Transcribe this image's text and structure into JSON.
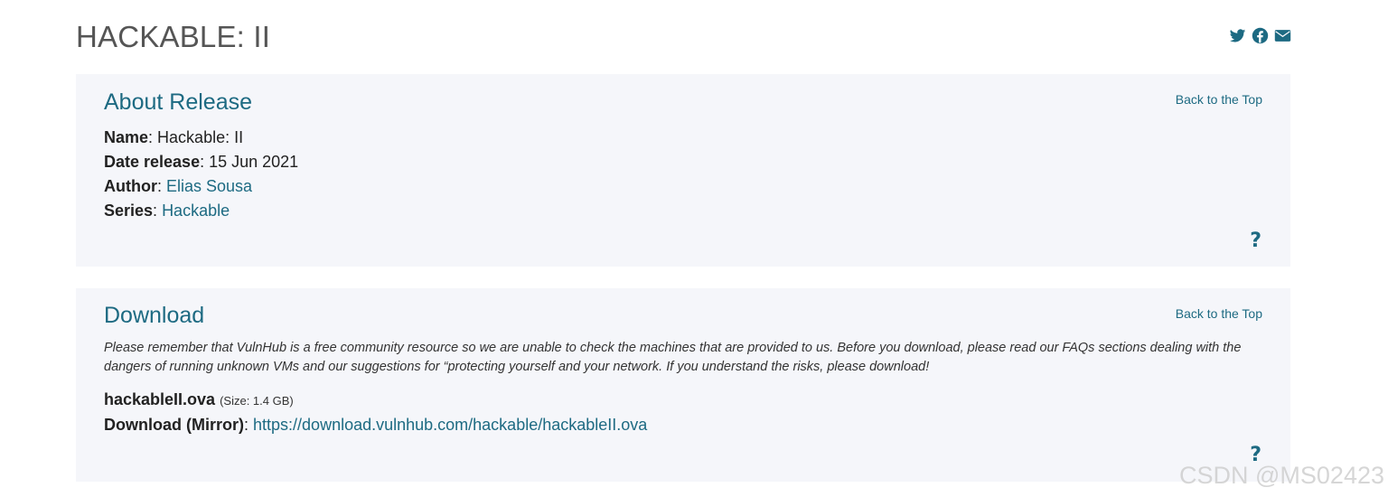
{
  "page": {
    "title": "HACKABLE: II"
  },
  "share": {
    "icons": [
      "twitter-icon",
      "facebook-icon",
      "envelope-icon"
    ],
    "color": "#1d6a82"
  },
  "about": {
    "heading": "About Release",
    "back_to_top": "Back to the Top",
    "fields": {
      "name_label": "Name",
      "name_value": "Hackable: II",
      "date_label": "Date release",
      "date_value": "15 Jun 2021",
      "author_label": "Author",
      "author_value": "Elias Sousa",
      "series_label": "Series",
      "series_value": "Hackable"
    },
    "help": "?"
  },
  "download": {
    "heading": "Download",
    "back_to_top": "Back to the Top",
    "notice": "Please remember that VulnHub is a free community resource so we are unable to check the machines that are provided to us. Before you download, please read our FAQs sections dealing with the dangers of running unknown VMs and our suggestions for  “protecting yourself and your network. If you understand the risks, please download!",
    "file_name": "hackableII.ova",
    "file_size": "(Size: 1.4 GB)",
    "mirror_label": "Download (Mirror)",
    "mirror_url": "https://download.vulnhub.com/hackable/hackableII.ova",
    "help": "?"
  },
  "watermark": "CSDN @MS02423",
  "colors": {
    "accent": "#1d6a82",
    "card_bg": "#f5f6fa",
    "title": "#555555"
  }
}
